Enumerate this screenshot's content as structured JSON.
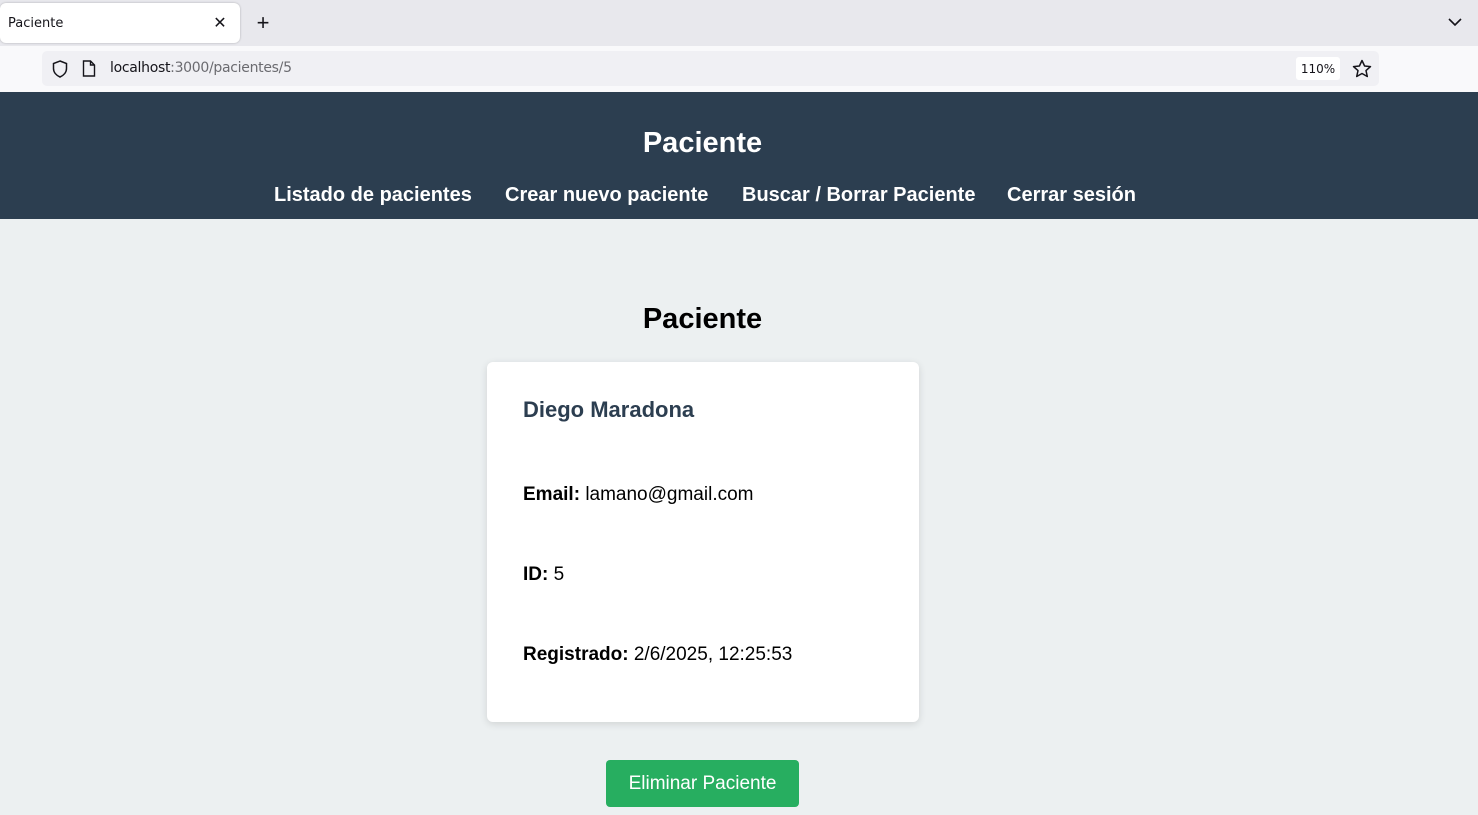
{
  "browser": {
    "tab_title": "Paciente",
    "url_host": "localhost",
    "url_path": ":3000/pacientes/5",
    "zoom": "110%"
  },
  "header": {
    "title": "Paciente",
    "nav": [
      {
        "label": "Listado de pacientes"
      },
      {
        "label": "Crear nuevo paciente"
      },
      {
        "label": "Buscar / Borrar Paciente"
      },
      {
        "label": "Cerrar sesión"
      }
    ]
  },
  "main": {
    "title": "Paciente",
    "patient": {
      "name": "Diego Maradona",
      "email_label": "Email:",
      "email": "lamano@gmail.com",
      "id_label": "ID:",
      "id": "5",
      "registered_label": "Registrado:",
      "registered": "2/6/2025, 12:25:53"
    },
    "delete_label": "Eliminar Paciente"
  },
  "colors": {
    "header_bg": "#2c3e50",
    "page_bg": "#ecf0f1",
    "delete_button": "#27ae60"
  }
}
